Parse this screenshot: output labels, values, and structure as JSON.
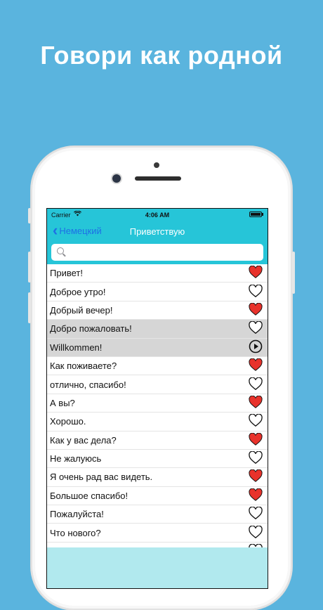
{
  "headline": "Говори как родной",
  "status_bar": {
    "carrier": "Carrier",
    "time": "4:06 AM"
  },
  "nav": {
    "back_label": "Немецкий",
    "title": "Приветствую"
  },
  "search": {
    "placeholder": ""
  },
  "colors": {
    "accent": "#26c5d8",
    "heart_filled": "#e8322b",
    "back_link": "#1e6fe6"
  },
  "phrases": [
    {
      "text": "Привет!",
      "icon": "heart-filled-icon",
      "selected": false
    },
    {
      "text": "Доброе утро!",
      "icon": "heart-outline-icon",
      "selected": false
    },
    {
      "text": "Добрый вечер!",
      "icon": "heart-filled-icon",
      "selected": false
    },
    {
      "text": "Добро пожаловать!",
      "icon": "heart-outline-icon",
      "selected": true
    },
    {
      "text": "Willkommen!",
      "icon": "play-icon",
      "selected": true
    },
    {
      "text": "Как поживаете?",
      "icon": "heart-filled-icon",
      "selected": false
    },
    {
      "text": "отлично, спасибо!",
      "icon": "heart-outline-icon",
      "selected": false
    },
    {
      "text": "А вы?",
      "icon": "heart-filled-icon",
      "selected": false
    },
    {
      "text": "Хорошо.",
      "icon": "heart-outline-icon",
      "selected": false
    },
    {
      "text": "Как у вас дела?",
      "icon": "heart-filled-icon",
      "selected": false
    },
    {
      "text": "Не жалуюсь",
      "icon": "heart-outline-icon",
      "selected": false
    },
    {
      "text": "Я очень рад вас видеть.",
      "icon": "heart-filled-icon",
      "selected": false
    },
    {
      "text": "Большое спасибо!",
      "icon": "heart-filled-icon",
      "selected": false
    },
    {
      "text": "Пожалуйста!",
      "icon": "heart-outline-icon",
      "selected": false
    },
    {
      "text": "Что нового?",
      "icon": "heart-outline-icon",
      "selected": false
    },
    {
      "text": "",
      "icon": "heart-outline-icon",
      "selected": false
    }
  ]
}
